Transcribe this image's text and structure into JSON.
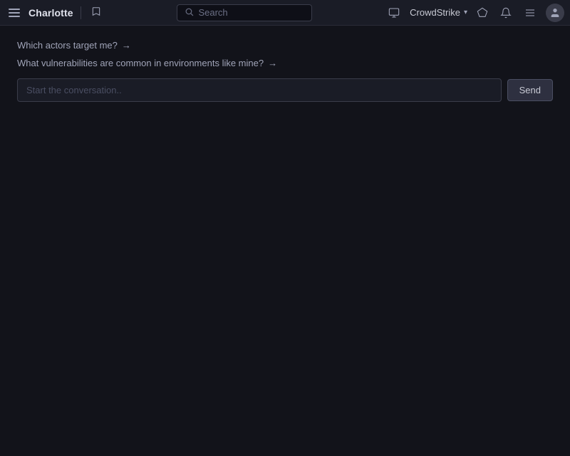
{
  "nav": {
    "title": "Charlotte",
    "search_placeholder": "Search",
    "crowdstrike_label": "CrowdStrike"
  },
  "suggestions": [
    {
      "text": "Which actors target me?",
      "arrow": "→"
    },
    {
      "text": "What vulnerabilities are common in environments like mine?",
      "arrow": "→"
    }
  ],
  "input": {
    "placeholder": "Start the conversation..",
    "send_label": "Send"
  }
}
